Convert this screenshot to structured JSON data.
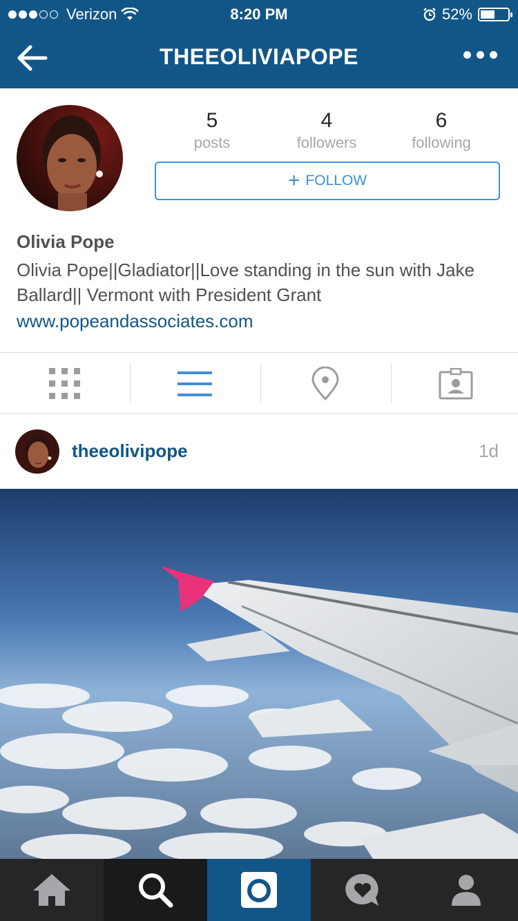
{
  "status_bar": {
    "carrier": "Verizon",
    "time": "8:20 PM",
    "battery": "52%",
    "battery_level": 0.52,
    "signal_bars": 3,
    "signal_total": 5
  },
  "nav": {
    "title": "THEEOLIVIAPOPE",
    "back_icon": "back-arrow-icon",
    "more_icon": "more-icon"
  },
  "profile": {
    "stats": [
      {
        "value": "5",
        "label": "posts"
      },
      {
        "value": "4",
        "label": "followers"
      },
      {
        "value": "6",
        "label": "following"
      }
    ],
    "follow_label": "FOLLOW",
    "name": "Olivia Pope",
    "bio": "Olivia Pope||Gladiator||Love standing in the sun with Jake Ballard|| Vermont with President Grant",
    "website": "www.popeandassociates.com"
  },
  "view_tabs": [
    "grid-view-icon",
    "list-view-icon",
    "location-pin-icon",
    "tagged-photos-icon"
  ],
  "active_tab": "list-view-icon",
  "post": {
    "username": "theeolivipope",
    "time": "1d"
  },
  "bottom_nav": [
    "home-icon",
    "search-icon",
    "camera-icon",
    "activity-icon",
    "profile-icon"
  ],
  "active_bottom": "camera-icon",
  "colors": {
    "brand": "#125688",
    "follow": "#3f8fd8",
    "muted": "#a5a7aa",
    "text": "#515151",
    "wingtip": "#e8327a"
  }
}
